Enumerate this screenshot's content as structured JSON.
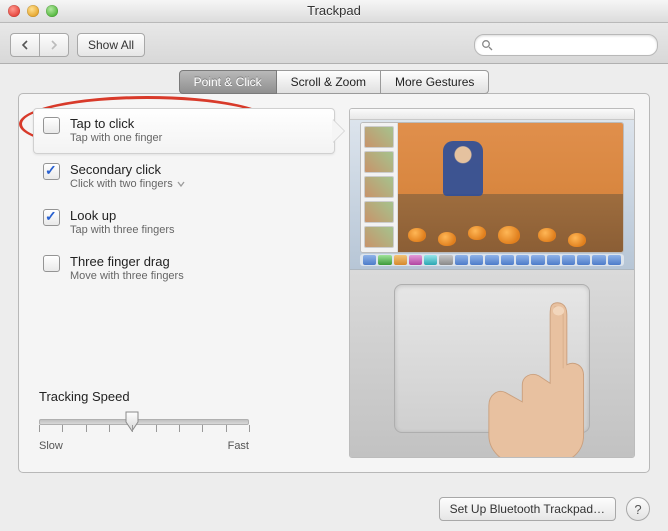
{
  "window": {
    "title": "Trackpad"
  },
  "toolbar": {
    "back_label": "Back",
    "forward_label": "Forward",
    "showall_label": "Show All"
  },
  "search": {
    "placeholder": ""
  },
  "tabs": [
    {
      "id": "point-click",
      "label": "Point & Click",
      "selected": true
    },
    {
      "id": "scroll-zoom",
      "label": "Scroll & Zoom",
      "selected": false
    },
    {
      "id": "more-gestures",
      "label": "More Gestures",
      "selected": false
    }
  ],
  "options": [
    {
      "id": "tap-to-click",
      "title": "Tap to click",
      "subtitle": "Tap with one finger",
      "checked": false,
      "selected": true,
      "has_menu": false
    },
    {
      "id": "secondary-click",
      "title": "Secondary click",
      "subtitle": "Click with two fingers",
      "checked": true,
      "selected": false,
      "has_menu": true
    },
    {
      "id": "look-up",
      "title": "Look up",
      "subtitle": "Tap with three fingers",
      "checked": true,
      "selected": false,
      "has_menu": false
    },
    {
      "id": "three-finger-drag",
      "title": "Three finger drag",
      "subtitle": "Move with three fingers",
      "checked": false,
      "selected": false,
      "has_menu": false
    }
  ],
  "slider": {
    "label": "Tracking Speed",
    "min_label": "Slow",
    "max_label": "Fast",
    "ticks": 10,
    "value_index": 4
  },
  "bottom": {
    "bluetooth_label": "Set Up Bluetooth Trackpad…",
    "help_label": "?"
  }
}
